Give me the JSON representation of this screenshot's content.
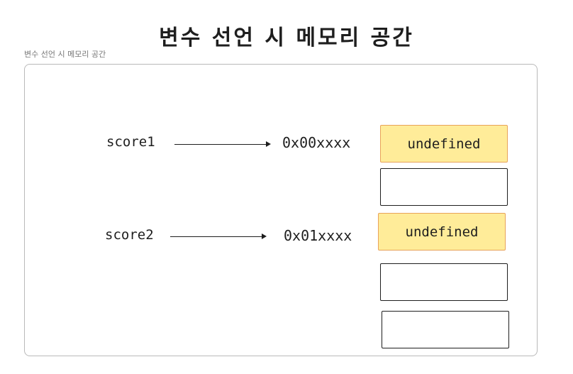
{
  "diagram": {
    "title": "변수 선언 시 메모리 공간",
    "frame_label": "변수 선언 시 메모리 공간",
    "variables": [
      {
        "name": "score1",
        "address": "0x00xxxx"
      },
      {
        "name": "score2",
        "address": "0x01xxxx"
      }
    ],
    "memory_cells": [
      {
        "value": "undefined",
        "filled": true
      },
      {
        "value": "",
        "filled": false
      },
      {
        "value": "undefined",
        "filled": true
      },
      {
        "value": "",
        "filled": false
      },
      {
        "value": "",
        "filled": false
      }
    ],
    "colors": {
      "filled_cell": "#ffec99",
      "filled_border": "#e8a35a",
      "frame_border": "#b9b9b9",
      "stroke": "#1e1e1e"
    }
  }
}
